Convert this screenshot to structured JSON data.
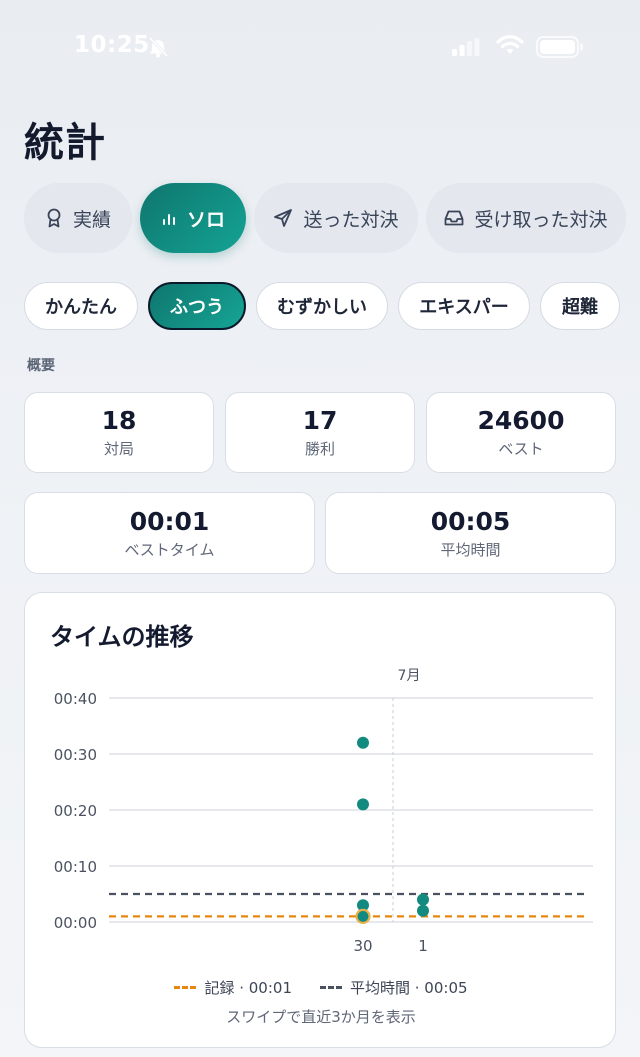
{
  "status_bar": {
    "time": "10:25",
    "icons": [
      "bell-slash-icon",
      "signal-icon",
      "wifi-icon",
      "battery-icon"
    ]
  },
  "page": {
    "title": "統計"
  },
  "mode_tabs": [
    {
      "label": "実績",
      "icon": "award-icon",
      "active": false
    },
    {
      "label": "ソロ",
      "icon": "bar-chart-icon",
      "active": true
    },
    {
      "label": "送った対決",
      "icon": "send-icon",
      "active": false
    },
    {
      "label": "受け取った対決",
      "icon": "inbox-icon",
      "active": false
    }
  ],
  "difficulty_tabs": [
    {
      "label": "かんたん",
      "active": false
    },
    {
      "label": "ふつう",
      "active": true
    },
    {
      "label": "むずかしい",
      "active": false
    },
    {
      "label": "エキスパー",
      "active": false
    },
    {
      "label": "超難",
      "active": false
    }
  ],
  "overview": {
    "section_label": "概要",
    "stats": [
      {
        "value": "18",
        "label": "対局"
      },
      {
        "value": "17",
        "label": "勝利"
      },
      {
        "value": "24600",
        "label": "ベスト"
      },
      {
        "value": "00:01",
        "label": "ベストタイム"
      },
      {
        "value": "00:05",
        "label": "平均時間"
      }
    ]
  },
  "colors": {
    "accent": "#0f766e",
    "point": "#138a80",
    "record_line": "#e8850c",
    "average_line": "#4a5262",
    "grid": "#d6dbe2"
  },
  "chart": {
    "title": "タイムの推移",
    "month_label": "7月",
    "legend": {
      "record": "記録 · 00:01",
      "average": "平均時間 · 00:05"
    },
    "hint": "スワイプで直近3か月を表示"
  },
  "chart_data": {
    "type": "scatter",
    "title": "タイムの推移",
    "y_unit": "seconds",
    "ylim": [
      0,
      40
    ],
    "y_ticks": [
      {
        "value": 0,
        "label": "00:00"
      },
      {
        "value": 10,
        "label": "00:10"
      },
      {
        "value": 20,
        "label": "00:20"
      },
      {
        "value": 30,
        "label": "00:30"
      },
      {
        "value": 40,
        "label": "00:40"
      }
    ],
    "x_ticks": [
      "30",
      "1"
    ],
    "month_marker": {
      "label": "7月",
      "after": "30"
    },
    "points": [
      {
        "x": "30",
        "y": 32
      },
      {
        "x": "30",
        "y": 21
      },
      {
        "x": "30",
        "y": 3
      },
      {
        "x": "30",
        "y": 1,
        "highlight": true
      },
      {
        "x": "1",
        "y": 4
      },
      {
        "x": "1",
        "y": 2
      }
    ],
    "reference_lines": [
      {
        "name": "記録",
        "value": 1,
        "style": "dashed",
        "color": "#e8850c"
      },
      {
        "name": "平均時間",
        "value": 5,
        "style": "dashed",
        "color": "#4a5262"
      }
    ],
    "grid": true,
    "legend_position": "bottom"
  }
}
